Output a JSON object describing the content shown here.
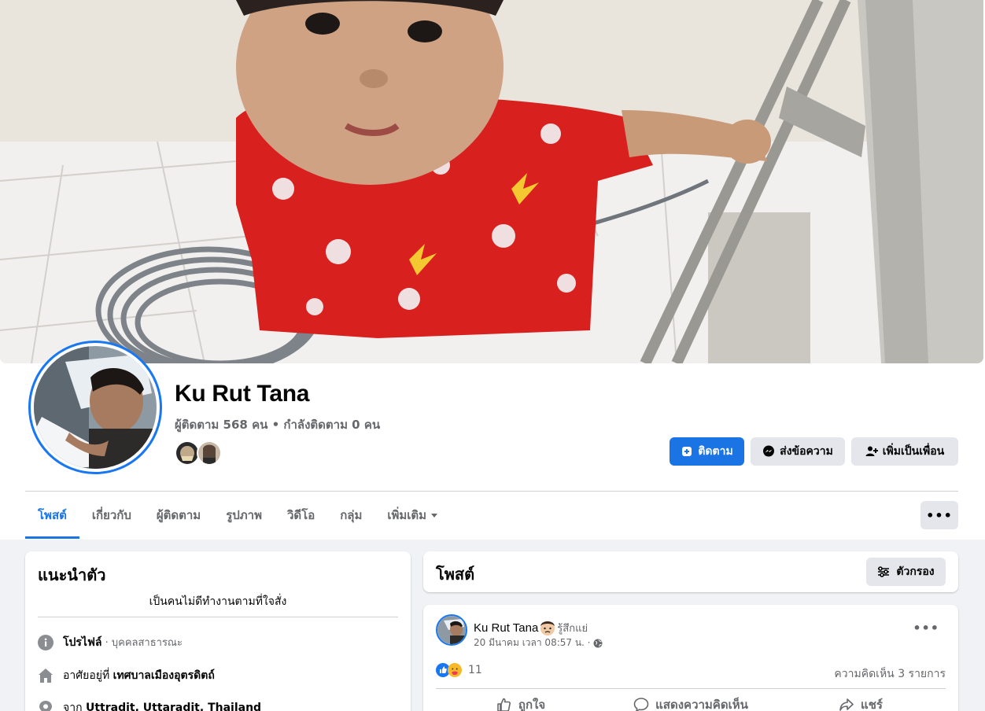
{
  "profile": {
    "name": "Ku Rut Tana",
    "stats": "ผู้ติดตาม 568 คน • กำลังติดตาม 0 คน"
  },
  "buttons": {
    "follow": "ติดตาม",
    "message": "ส่งข้อความ",
    "add_friend": "เพิ่มเป็นเพื่อน",
    "more": "•••"
  },
  "tabs": [
    {
      "label": "โพสต์",
      "active": true
    },
    {
      "label": "เกี่ยวกับ"
    },
    {
      "label": "ผู้ติดตาม"
    },
    {
      "label": "รูปภาพ"
    },
    {
      "label": "วิดีโอ"
    },
    {
      "label": "กลุ่ม"
    },
    {
      "label": "เพิ่มเติม"
    }
  ],
  "intro": {
    "title": "แนะนำตัว",
    "bio": "เป็นคนไม่ดีทำงานตามที่ใจสั่ง",
    "profile_label": "โปรไฟล์",
    "profile_type": " · บุคคลสาธารณะ",
    "lives_prefix": "อาศัยอยู่ที่ ",
    "lives_place": "เทศบาลเมืองอุตรดิตถ์",
    "from_prefix": "จาก ",
    "from_place": "Uttradit, Uttaradit, Thailand"
  },
  "posts_header": {
    "title": "โพสต์",
    "filter": "ตัวกรอง"
  },
  "post": {
    "author": "Ku Rut Tana",
    "feeling": "รู้สึกแย่",
    "date": "20 มีนาคม เวลา 08:57 น. ·",
    "more": "•••",
    "reaction_count": "11",
    "comment_count": "ความคิดเห็น 3 รายการ",
    "like": "ถูกใจ",
    "comment": "แสดงความคิดเห็น",
    "share": "แชร์"
  },
  "colors": {
    "accent": "#1b74e4",
    "button_gray": "#e4e6eb",
    "page_bg": "#f0f2f5",
    "shirt_red": "#d8201f"
  }
}
